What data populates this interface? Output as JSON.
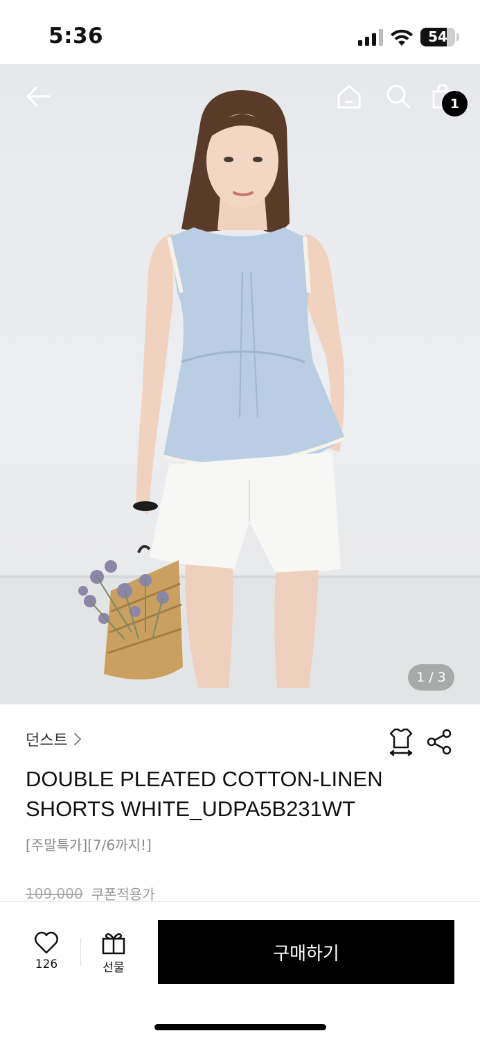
{
  "status_bar": {
    "time": "5:36",
    "battery": "54"
  },
  "gallery": {
    "counter": "1 / 3",
    "cart_count": "1"
  },
  "product": {
    "brand": "던스트",
    "title": "DOUBLE PLEATED COTTON-LINEN SHORTS WHITE_UDPA5B231WT",
    "promo": "[주말특가][7/6까지!]",
    "original_price": "109,000",
    "coupon_label": "쿠폰적용가"
  },
  "actions": {
    "like_count": "126",
    "gift_label": "선물",
    "buy_label": "구매하기"
  },
  "icons": {
    "back": "arrow-left-icon",
    "home": "home-icon",
    "search": "search-icon",
    "cart": "shopping-bag-icon",
    "size": "size-guide-icon",
    "share": "share-icon",
    "like": "heart-icon",
    "gift": "gift-icon"
  }
}
